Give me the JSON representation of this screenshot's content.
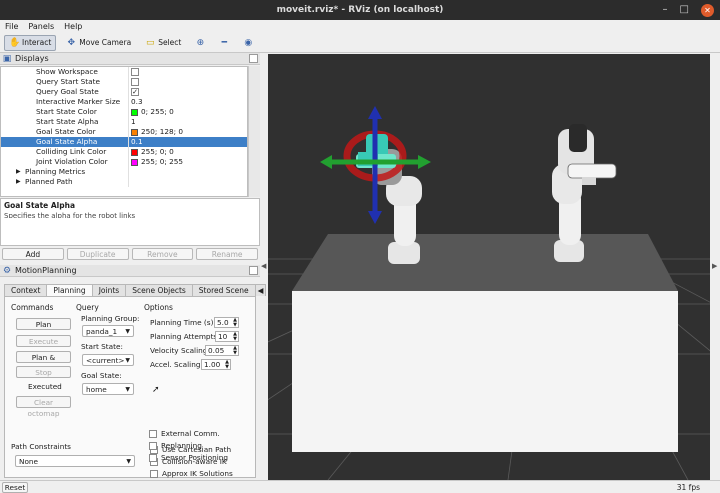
{
  "window": {
    "title": "moveit.rviz* - RViz (on localhost)"
  },
  "menu": {
    "file": "File",
    "panels": "Panels",
    "help": "Help"
  },
  "toolbar": {
    "interact": "Interact",
    "move_camera": "Move Camera",
    "select": "Select"
  },
  "displays": {
    "title": "Displays",
    "rows": [
      {
        "name": "Show Workspace",
        "kind": "check",
        "checked": false
      },
      {
        "name": "Query Start State",
        "kind": "check",
        "checked": false
      },
      {
        "name": "Query Goal State",
        "kind": "check",
        "checked": true
      },
      {
        "name": "Interactive Marker Size",
        "value": "0.3"
      },
      {
        "name": "Start State Color",
        "value": "0; 255; 0",
        "color": "#00ff00"
      },
      {
        "name": "Start State Alpha",
        "value": "1"
      },
      {
        "name": "Goal State Color",
        "value": "250; 128; 0",
        "color": "#fa8000"
      },
      {
        "name": "Goal State Alpha",
        "value": "0.1",
        "selected": true
      },
      {
        "name": "Colliding Link Color",
        "value": "255; 0; 0",
        "color": "#ff0000"
      },
      {
        "name": "Joint Violation Color",
        "value": "255; 0; 255",
        "color": "#ff00ff"
      },
      {
        "name": "Planning Metrics",
        "group": true
      },
      {
        "name": "Planned Path",
        "group": true
      }
    ],
    "desc_title": "Goal State Alpha",
    "desc_text": "Specifies the alpha for the robot links",
    "buttons": [
      "Add",
      "Duplicate",
      "Remove",
      "Rename"
    ]
  },
  "motion_planning": {
    "title": "MotionPlanning",
    "tabs": [
      "Context",
      "Planning",
      "Joints",
      "Scene Objects",
      "Stored Scene"
    ],
    "commands": {
      "header": "Commands",
      "plan": "Plan",
      "execute": "Execute",
      "plan_execute": "Plan & Execute",
      "stop": "Stop",
      "status": "Executed",
      "clear": "Clear octomap"
    },
    "query": {
      "header": "Query",
      "planning_group_label": "Planning Group:",
      "planning_group": "panda_1",
      "start_state_label": "Start State:",
      "start_state": "<current>",
      "goal_state_label": "Goal State:",
      "goal_state": "home"
    },
    "options": {
      "header": "Options",
      "planning_time_label": "Planning Time (s):",
      "planning_time": "5.0",
      "planning_attempts_label": "Planning Attempts:",
      "planning_attempts": "10",
      "velocity_scaling_label": "Velocity Scaling:",
      "velocity_scaling": "0.05",
      "accel_scaling_label": "Accel. Scaling:",
      "accel_scaling": "1.00",
      "checks": [
        "Use Cartesian Path",
        "Collision-aware IK",
        "Approx IK Solutions",
        "External Comm.",
        "Replanning",
        "Sensor Positioning"
      ]
    },
    "path_constraints": {
      "label": "Path Constraints",
      "value": "None"
    }
  },
  "statusbar": {
    "reset": "Reset",
    "fps": "31 fps"
  }
}
